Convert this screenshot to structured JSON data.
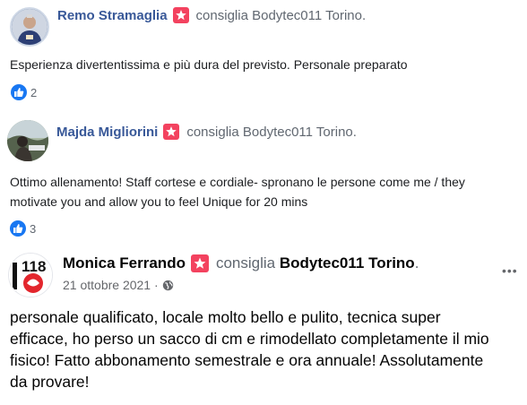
{
  "reviews": [
    {
      "author": "Remo Stramaglia",
      "verb": "consiglia",
      "page": "Bodytec011 Torino.",
      "text": "Esperienza divertentissima e più dura del previsto. Personale preparato",
      "likes": "2"
    },
    {
      "author": "Majda Migliorini",
      "verb": "consiglia",
      "page": "Bodytec011 Torino.",
      "text_line1": "Ottimo allenamento! Staff cortese e cordiale- spronano le persone come me / they",
      "text_line2": "motivate you and allow you to feel Unique for 20 mins",
      "likes": "3"
    },
    {
      "author": "Monica Ferrando",
      "verb": "consiglia",
      "page": "Bodytec011 Torino",
      "page_suffix": ".",
      "date": "21 ottobre 2021 ·",
      "more": "•••",
      "avatar_text": "118",
      "text_line1": "personale qualificato, locale molto bello e pulito, tecnica super",
      "text_line2": "efficace, ho perso un sacco di cm e rimodellato completamente il mio",
      "text_line3": "fisico! Fatto abbonamento semestrale e ora annuale! Assolutamente",
      "text_line4": "da provare!"
    }
  ],
  "colors": {
    "author_link": "#385898",
    "recommend_badge": "#f3425f",
    "like_blue": "#1877f2",
    "secondary_text": "#606770"
  }
}
